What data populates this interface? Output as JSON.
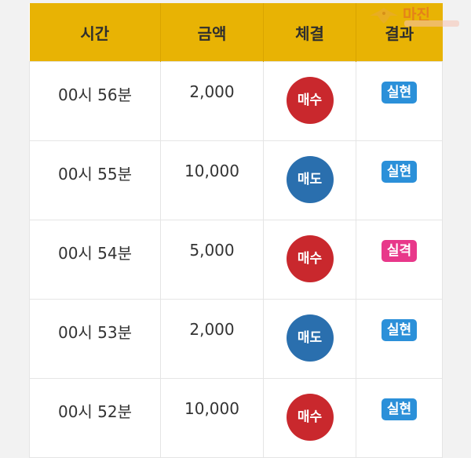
{
  "watermark": {
    "text": "마진",
    "logo_icon": "eagle-logo-icon"
  },
  "table": {
    "headers": [
      "시간",
      "금액",
      "체결",
      "결과"
    ],
    "rows": [
      {
        "time": "00시 56분",
        "amount": "2,000",
        "trade": "매수",
        "trade_color": "#c9282d",
        "result": "실현",
        "result_color": "#2b90d9"
      },
      {
        "time": "00시 55분",
        "amount": "10,000",
        "trade": "매도",
        "trade_color": "#2a6fae",
        "result": "실현",
        "result_color": "#2b90d9"
      },
      {
        "time": "00시 54분",
        "amount": "5,000",
        "trade": "매수",
        "trade_color": "#c9282d",
        "result": "실격",
        "result_color": "#e8388a"
      },
      {
        "time": "00시 53분",
        "amount": "2,000",
        "trade": "매도",
        "trade_color": "#2a6fae",
        "result": "실현",
        "result_color": "#2b90d9"
      },
      {
        "time": "00시 52분",
        "amount": "10,000",
        "trade": "매수",
        "trade_color": "#c9282d",
        "result": "실현",
        "result_color": "#2b90d9"
      }
    ]
  },
  "colors": {
    "header_bg": "#e8b304",
    "buy": "#c9282d",
    "sell": "#2a6fae",
    "success": "#2b90d9",
    "fail": "#e8388a"
  }
}
